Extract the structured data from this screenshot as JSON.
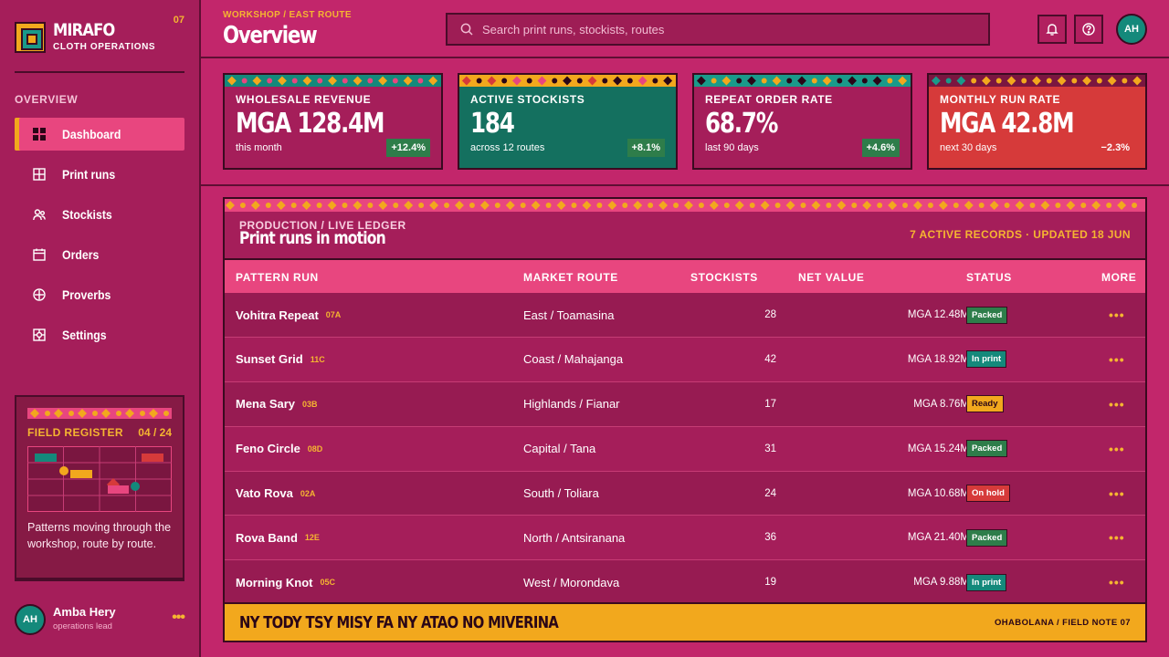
{
  "brand": {
    "name": "MIRAFO",
    "subtitle": "CLOTH OPERATIONS",
    "number": "07"
  },
  "nav": {
    "heading": "OVERVIEW",
    "items": [
      {
        "label": "Dashboard",
        "icon": "grid-icon",
        "active": true
      },
      {
        "label": "Print runs",
        "icon": "table-icon"
      },
      {
        "label": "Stockists",
        "icon": "users-icon"
      },
      {
        "label": "Orders",
        "icon": "calendar-icon"
      },
      {
        "label": "Proverbs",
        "icon": "crosshair-icon"
      },
      {
        "label": "Settings",
        "icon": "settings-icon"
      }
    ]
  },
  "field": {
    "title": "FIELD REGISTER",
    "count": "04 / 24",
    "text": "Patterns moving through the workshop, route by route."
  },
  "user": {
    "initials": "AH",
    "name": "Amba Hery",
    "role": "operations lead",
    "more": "•••"
  },
  "header": {
    "crumb": "WORKSHOP / EAST ROUTE",
    "title": "Overview",
    "search_placeholder": "Search print runs, stockists, routes",
    "avatar": "AH"
  },
  "kpis": [
    {
      "label": "WHOLESALE REVENUE",
      "value": "MGA 128.4M",
      "sub": "this month",
      "delta": "+12.4%"
    },
    {
      "label": "ACTIVE STOCKISTS",
      "value": "184",
      "sub": "across 12 routes",
      "delta": "+8.1%"
    },
    {
      "label": "REPEAT ORDER RATE",
      "value": "68.7%",
      "sub": "last 90 days",
      "delta": "+4.6%"
    },
    {
      "label": "MONTHLY RUN RATE",
      "value": "MGA 42.8M",
      "sub": "next 30 days",
      "delta": "−2.3%"
    }
  ],
  "ledger": {
    "kicker": "PRODUCTION / LIVE LEDGER",
    "title": "Print runs in motion",
    "meta": "7 ACTIVE RECORDS · UPDATED 18 JUN",
    "columns": {
      "run": "PATTERN RUN",
      "route": "MARKET ROUTE",
      "stockists": "STOCKISTS",
      "value": "NET VALUE",
      "status": "STATUS",
      "more": "MORE"
    },
    "rows": [
      {
        "name": "Vohitra Repeat",
        "code": "07A",
        "route": "East / Toamasina",
        "stockists": "28",
        "value": "MGA 12.48M",
        "status": "Packed",
        "status_color": "#2e7d4a"
      },
      {
        "name": "Sunset Grid",
        "code": "11C",
        "route": "Coast / Mahajanga",
        "stockists": "42",
        "value": "MGA 18.92M",
        "status": "In print",
        "status_color": "#14897b"
      },
      {
        "name": "Mena Sary",
        "code": "03B",
        "route": "Highlands / Fianar",
        "stockists": "17",
        "value": "MGA 8.76M",
        "status": "Ready",
        "status_color": "#f2a81d"
      },
      {
        "name": "Feno Circle",
        "code": "08D",
        "route": "Capital / Tana",
        "stockists": "31",
        "value": "MGA 15.24M",
        "status": "Packed",
        "status_color": "#2e7d4a"
      },
      {
        "name": "Vato Rova",
        "code": "02A",
        "route": "South / Toliara",
        "stockists": "24",
        "value": "MGA 10.68M",
        "status": "On hold",
        "status_color": "#d63a3a"
      },
      {
        "name": "Rova Band",
        "code": "12E",
        "route": "North / Antsiranana",
        "stockists": "36",
        "value": "MGA 21.40M",
        "status": "Packed",
        "status_color": "#2e7d4a"
      },
      {
        "name": "Morning Knot",
        "code": "05C",
        "route": "West / Morondava",
        "stockists": "19",
        "value": "MGA 9.88M",
        "status": "In print",
        "status_color": "#14897b"
      }
    ],
    "more_glyph": "•••",
    "footer_text": "NY TODY TSY MISY FA NY ATAO NO MIVERINA",
    "footer_note": "OHABOLANA / FIELD NOTE 07"
  },
  "colors": {
    "background": "#c2266b",
    "sidebar": "#a51e5a",
    "accent_yellow": "#f2a81d",
    "teal": "#14897b",
    "pink": "#e8467f",
    "red": "#d63a3a",
    "green": "#2e7d4a"
  }
}
